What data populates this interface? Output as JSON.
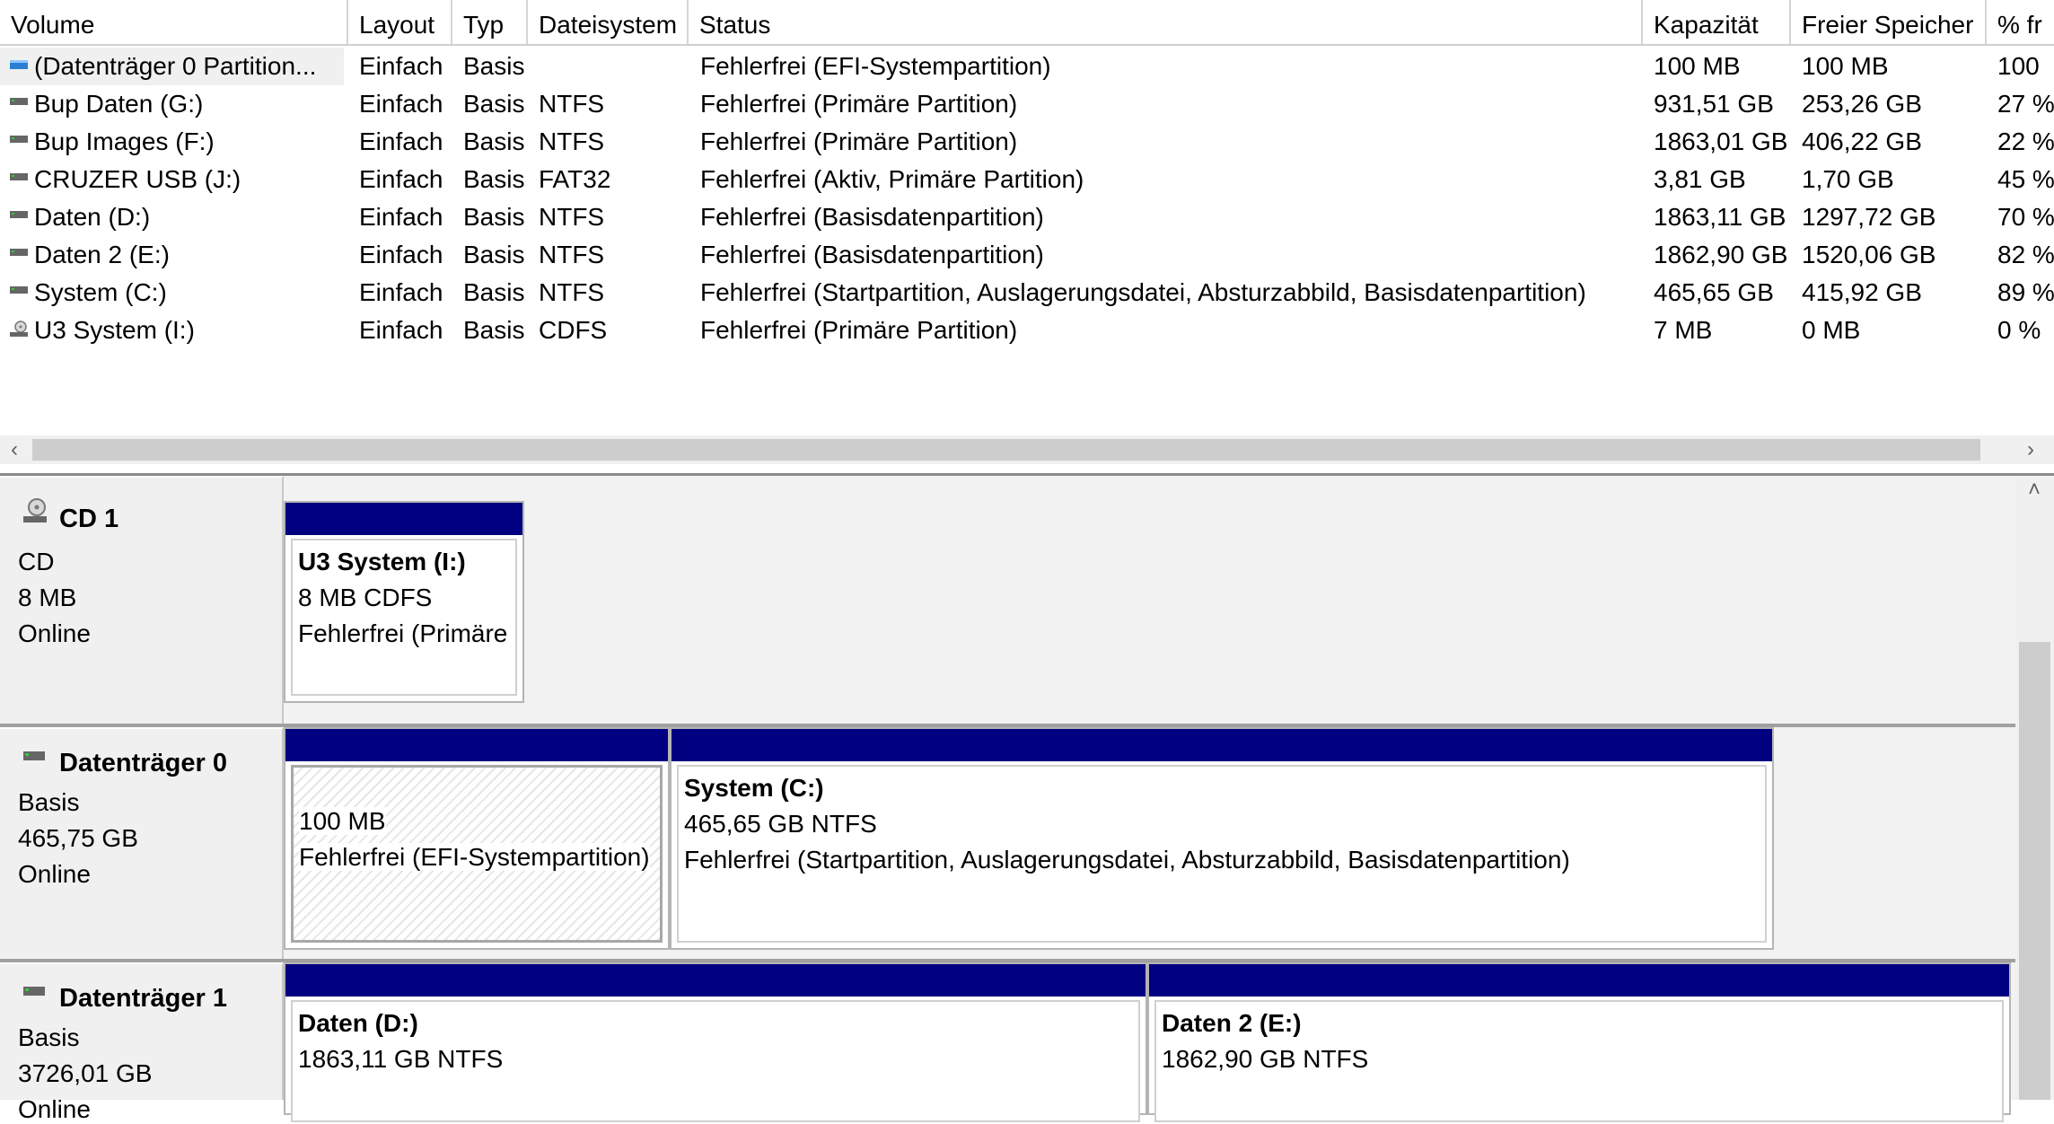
{
  "columns": [
    "Volume",
    "Layout",
    "Typ",
    "Dateisystem",
    "Status",
    "Kapazität",
    "Freier Speicher",
    "% fr"
  ],
  "volumes": [
    {
      "name": "(Datenträger 0 Partition...",
      "layout": "Einfach",
      "typ": "Basis",
      "fs": "",
      "status": "Fehlerfrei (EFI-Systempartition)",
      "cap": "100 MB",
      "free": "100 MB",
      "pct": "100",
      "icon": "volume-blue-icon"
    },
    {
      "name": "Bup Daten (G:)",
      "layout": "Einfach",
      "typ": "Basis",
      "fs": "NTFS",
      "status": "Fehlerfrei (Primäre Partition)",
      "cap": "931,51 GB",
      "free": "253,26 GB",
      "pct": "27 %",
      "icon": "drive-icon"
    },
    {
      "name": "Bup Images (F:)",
      "layout": "Einfach",
      "typ": "Basis",
      "fs": "NTFS",
      "status": "Fehlerfrei (Primäre Partition)",
      "cap": "1863,01 GB",
      "free": "406,22 GB",
      "pct": "22 %",
      "icon": "drive-icon"
    },
    {
      "name": "CRUZER USB (J:)",
      "layout": "Einfach",
      "typ": "Basis",
      "fs": "FAT32",
      "status": "Fehlerfrei (Aktiv, Primäre Partition)",
      "cap": "3,81 GB",
      "free": "1,70 GB",
      "pct": "45 %",
      "icon": "drive-icon"
    },
    {
      "name": "Daten (D:)",
      "layout": "Einfach",
      "typ": "Basis",
      "fs": "NTFS",
      "status": "Fehlerfrei (Basisdatenpartition)",
      "cap": "1863,11 GB",
      "free": "1297,72 GB",
      "pct": "70 %",
      "icon": "drive-icon"
    },
    {
      "name": "Daten 2 (E:)",
      "layout": "Einfach",
      "typ": "Basis",
      "fs": "NTFS",
      "status": "Fehlerfrei (Basisdatenpartition)",
      "cap": "1862,90 GB",
      "free": "1520,06 GB",
      "pct": "82 %",
      "icon": "drive-icon"
    },
    {
      "name": "System (C:)",
      "layout": "Einfach",
      "typ": "Basis",
      "fs": "NTFS",
      "status": "Fehlerfrei (Startpartition, Auslagerungsdatei, Absturzabbild, Basisdatenpartition)",
      "cap": "465,65 GB",
      "free": "415,92 GB",
      "pct": "89 %",
      "icon": "drive-icon"
    },
    {
      "name": "U3 System (I:)",
      "layout": "Einfach",
      "typ": "Basis",
      "fs": "CDFS",
      "status": "Fehlerfrei (Primäre Partition)",
      "cap": "7 MB",
      "free": "0 MB",
      "pct": "0 %",
      "icon": "cd-drive-icon"
    }
  ],
  "scroll": {
    "left": "‹",
    "right": "›",
    "up": "˄"
  },
  "disks": {
    "cd1": {
      "name": "CD 1",
      "type": "CD",
      "size": "8 MB",
      "state": "Online",
      "partitions": [
        {
          "title": "U3 System  (I:)",
          "line1": "8 MB CDFS",
          "line2": "Fehlerfrei (Primäre Partition)"
        }
      ]
    },
    "disk0": {
      "name": "Datenträger 0",
      "type": "Basis",
      "size": "465,75 GB",
      "state": "Online",
      "partitions": [
        {
          "title": "",
          "line1": "100 MB",
          "line2": "Fehlerfrei (EFI-Systempartition)"
        },
        {
          "title": "System  (C:)",
          "line1": "465,65 GB NTFS",
          "line2": "Fehlerfrei (Startpartition, Auslagerungsdatei, Absturzabbild, Basisdatenpartition)"
        }
      ]
    },
    "disk1": {
      "name": "Datenträger 1",
      "type": "Basis",
      "size": "3726,01 GB",
      "state": "Online",
      "partitions": [
        {
          "title": "Daten  (D:)",
          "line1": "1863,11 GB NTFS"
        },
        {
          "title": "Daten 2  (E:)",
          "line1": "1862,90 GB NTFS"
        }
      ]
    }
  }
}
